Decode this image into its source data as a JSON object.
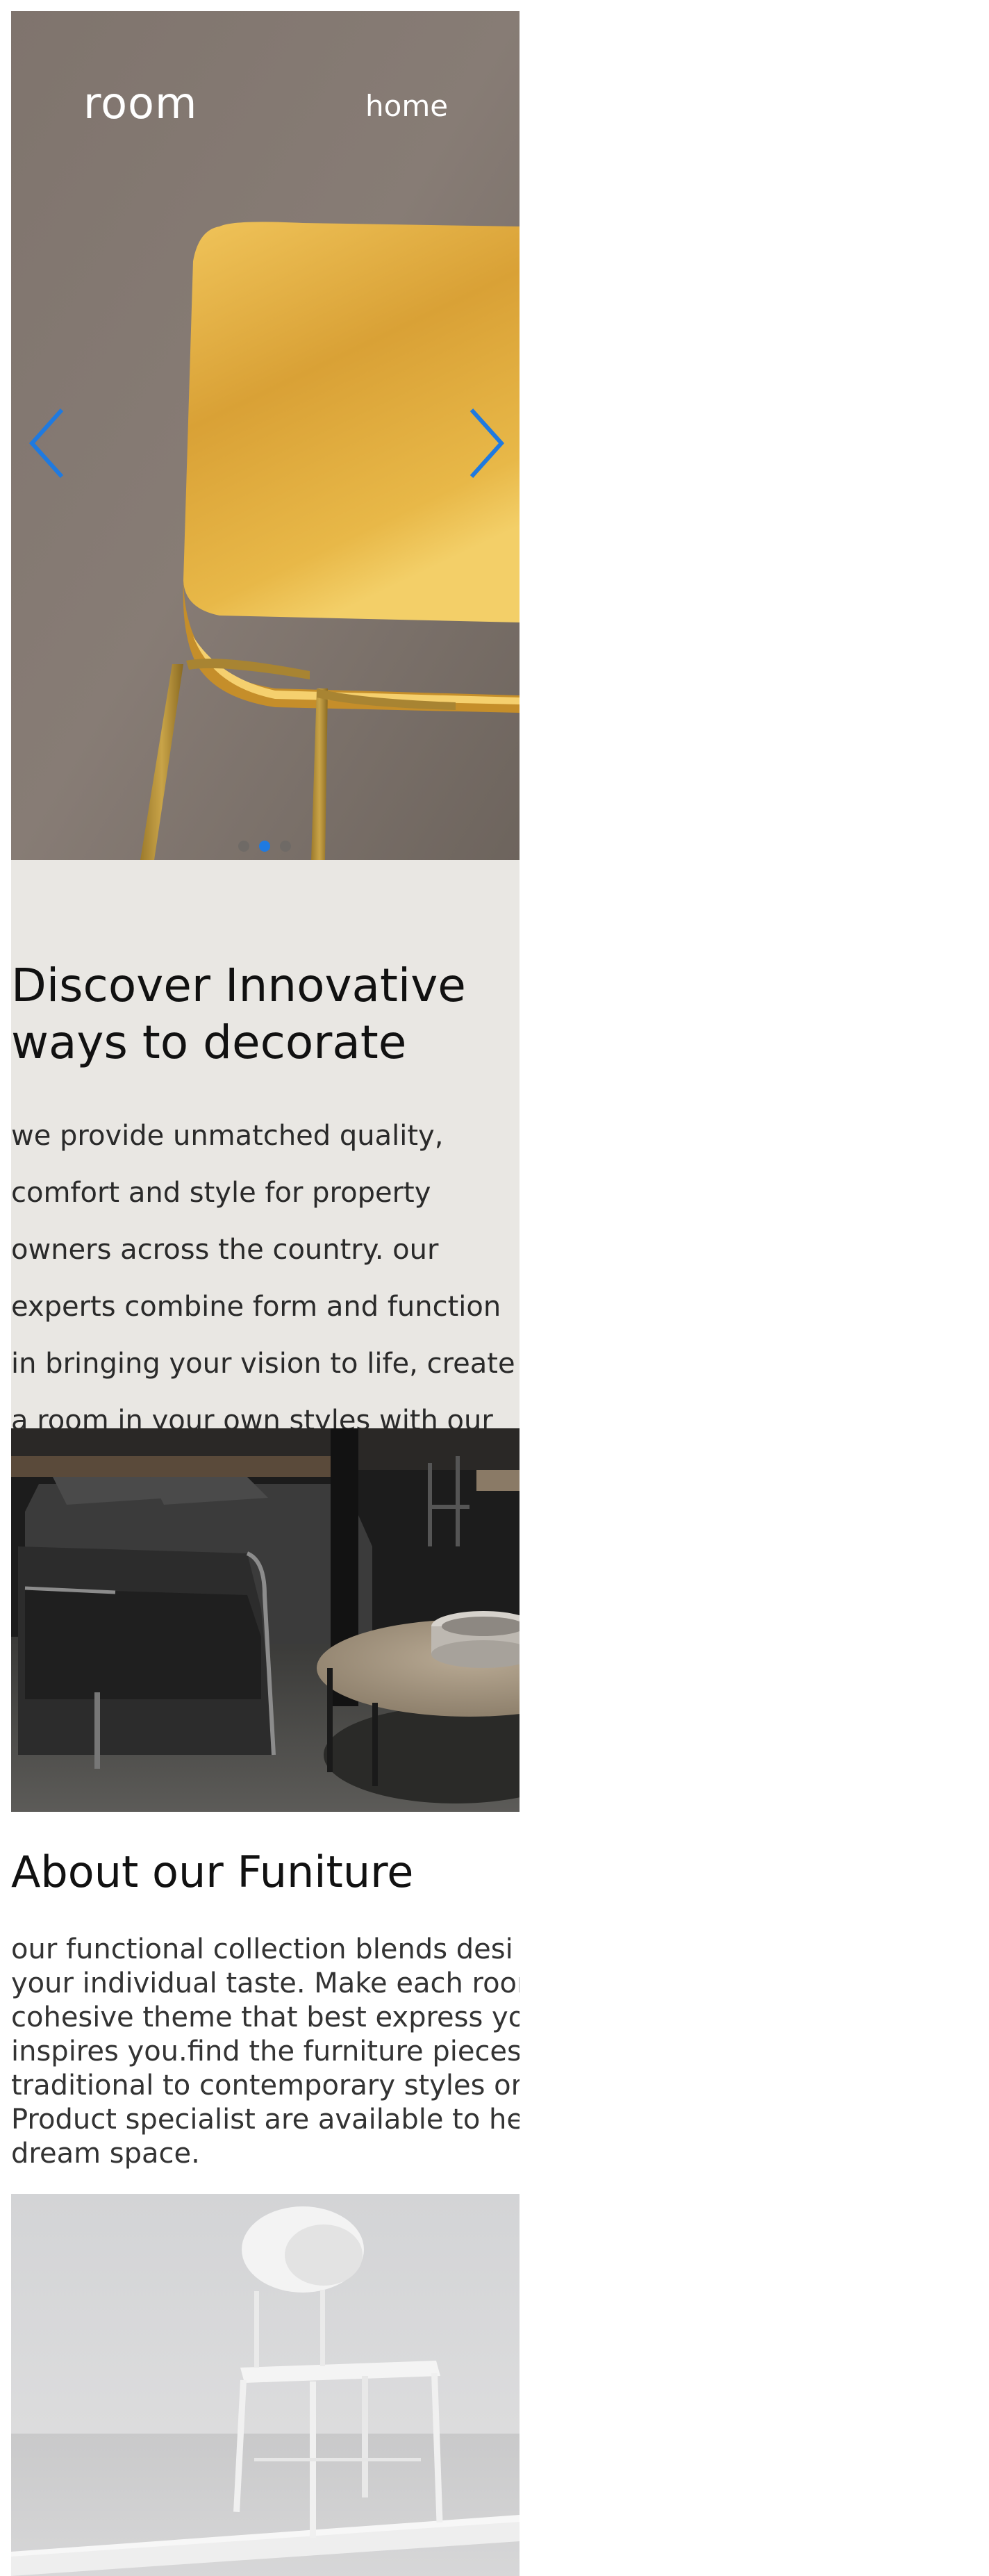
{
  "header": {
    "logo": "room",
    "nav_home": "home"
  },
  "hero": {
    "slides_count": 3,
    "active_slide": 2,
    "prev_icon": "chevron-left-icon",
    "next_icon": "chevron-right-icon",
    "accent_color": "#1f7ae0",
    "chair_color": "#e2a93a"
  },
  "discover": {
    "title_line1": "Discover Innovative",
    "title_line2": "ways to decorate",
    "text": "we provide unmatched quality, comfort and style for property owners across the country. our experts combine form and function in bringing your vision to life, create a room in your own styles with our"
  },
  "about": {
    "title": "About our Funiture",
    "lines": [
      "our functional collection blends desi",
      "your individual taste. Make each roor",
      "cohesive theme that best express yo",
      "inspires you.find the furniture pieces",
      "traditional to contemporary styles or",
      "Product specialist are available to he",
      "dream space."
    ]
  }
}
